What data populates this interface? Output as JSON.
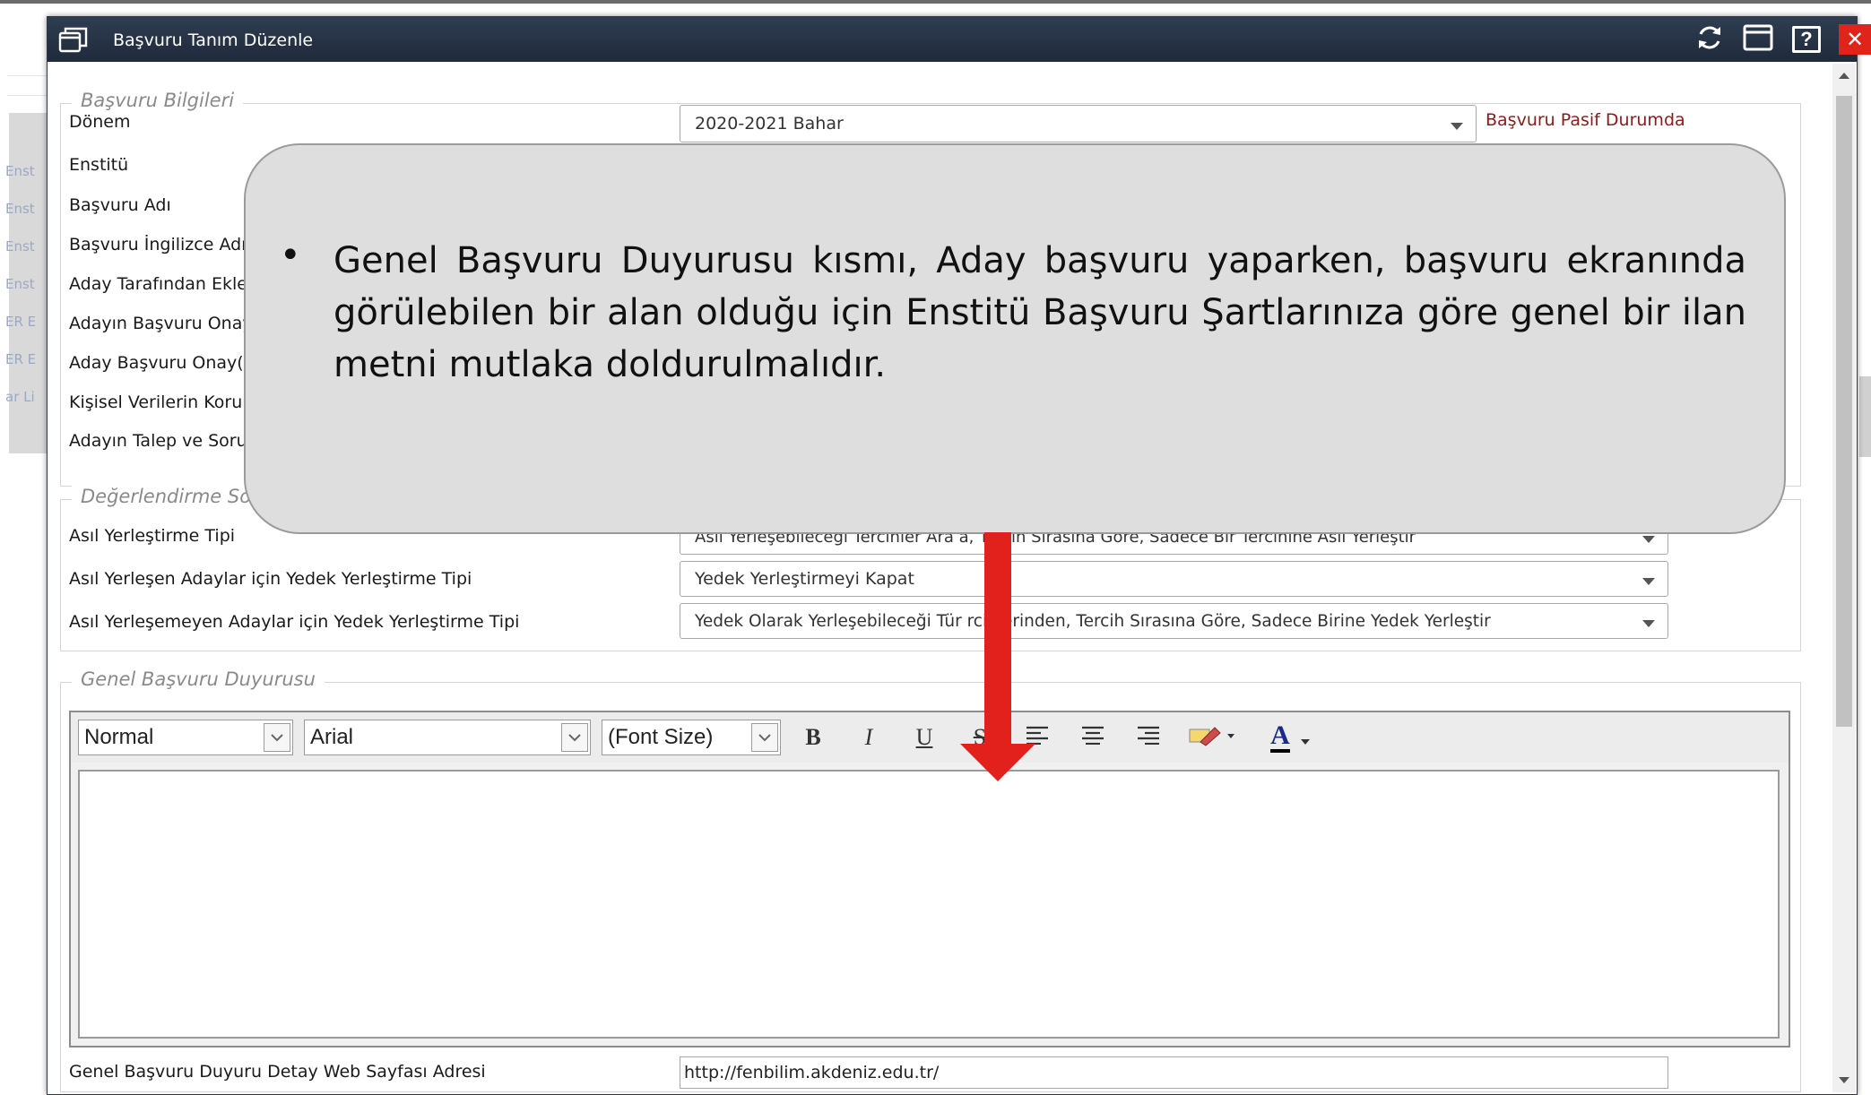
{
  "background": {
    "left_items": [
      "Enst",
      "Enst",
      "Enst",
      "Enst",
      "ER E",
      "ER E",
      "ar Li"
    ]
  },
  "dialog": {
    "title": "Başvuru Tanım Düzenle",
    "title_icon": "window-restore-icon",
    "buttons": {
      "refresh_icon": "refresh-icon",
      "maximize_icon": "maximize-icon",
      "help_label": "?",
      "close_label": "✕"
    }
  },
  "basvuru_bilgileri": {
    "legend": "Başvuru Bilgileri",
    "labels": {
      "donem": "Dönem",
      "enstitu": "Enstitü",
      "basvuru_adi": "Başvuru Adı",
      "basvuru_ingilizce_adi": "Başvuru İngilizce Adı",
      "aday_tarafindan": "Aday Tarafından Ekle",
      "aday_basvuru_onay": "Adayın Başvuru Onay",
      "aday_basvuru_onay2": "Aday Başvuru Onay(",
      "kisisel_veriler": "Kişisel Verilerin Korun",
      "aday_talep": "Adayın Talep ve Soru"
    },
    "donem_value": "2020-2021 Bahar",
    "status_text": "Başvuru Pasif Durumda"
  },
  "degerlendirme": {
    "legend": "Değerlendirme Sor",
    "rows": [
      {
        "label": "Asıl Yerleştirme Tipi",
        "value": "Asıl Yerleşebileceği Tercihler Ara    a, Tercih Sırasına Göre, Sadece Bir Tercihine Asıl Yerleştir"
      },
      {
        "label": "Asıl Yerleşen Adaylar için Yedek Yerleştirme Tipi",
        "value": "Yedek Yerleştirmeyi Kapat"
      },
      {
        "label": "Asıl Yerleşemeyen Adaylar için Yedek Yerleştirme Tipi",
        "value": "Yedek Olarak Yerleşebileceği Tür     rcihlerinden, Tercih Sırasına Göre, Sadece Birine Yedek Yerleştir"
      }
    ]
  },
  "genel_duyuru": {
    "legend": "Genel Başvuru Duyurusu",
    "editor": {
      "format_value": "Normal",
      "font_value": "Arial",
      "size_value": "(Font Size)",
      "bold": "B",
      "italic": "I",
      "underline": "U",
      "strike": "S",
      "font_color_label": "A"
    },
    "web_label": "Genel Başvuru Duyuru Detay Web Sayfası Adresi",
    "web_value": "http://fenbilim.akdeniz.edu.tr/"
  },
  "callout": {
    "bullet": "•",
    "text": "Genel Başvuru Duyurusu kısmı, Aday başvuru yaparken, başvuru ekranında görülebilen bir alan olduğu için Enstitü Başvuru Şartlarınıza göre genel bir ilan metni mutlaka  doldurulmalıdır."
  },
  "colors": {
    "titlebar": "#243042",
    "close": "#e0241b",
    "status": "#8b1a1a",
    "arrow": "#e3211c",
    "callout_bg": "#dedede"
  }
}
